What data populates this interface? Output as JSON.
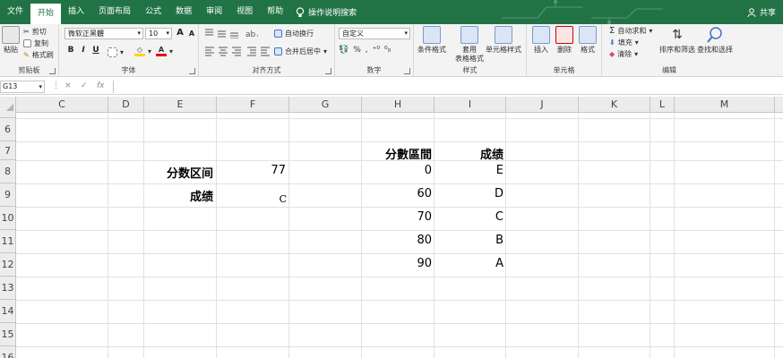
{
  "menu": {
    "tabs": [
      "文件",
      "开始",
      "插入",
      "页面布局",
      "公式",
      "数据",
      "审阅",
      "视图",
      "帮助"
    ],
    "active": "开始",
    "tell_me": "操作说明搜索",
    "share": "共享"
  },
  "ribbon": {
    "clipboard": {
      "paste": "粘贴",
      "cut": "剪切",
      "copy": "复制",
      "format_painter": "格式刷",
      "label": "剪贴板"
    },
    "font": {
      "name": "微软正黑體",
      "size": "10",
      "grow": "A",
      "shrink": "A",
      "bold": "B",
      "italic": "I",
      "underline": "U",
      "label": "字体"
    },
    "alignment": {
      "wrap": "自动换行",
      "merge": "合并后居中",
      "label": "对齐方式"
    },
    "number": {
      "format": "自定义",
      "label": "数字"
    },
    "styles": {
      "conditional": "条件格式",
      "table_line1": "套用",
      "table_line2": "表格格式",
      "cell_styles": "单元格样式",
      "label": "样式"
    },
    "cells": {
      "insert": "插入",
      "delete": "删除",
      "format": "格式",
      "label": "单元格"
    },
    "editing": {
      "autosum": "自动求和",
      "fill": "填充",
      "clear": "清除",
      "sort": "排序和筛选",
      "find": "查找和选择",
      "label": "编辑"
    }
  },
  "formula_bar": {
    "name_box": "G13",
    "cancel": "×",
    "enter": "✓",
    "fx": "fx",
    "value": ""
  },
  "columns": [
    "C",
    "D",
    "E",
    "F",
    "G",
    "H",
    "I",
    "J",
    "K",
    "L",
    "M"
  ],
  "rows": [
    "",
    "6",
    "7",
    "8",
    "9",
    "10",
    "11",
    "12",
    "13",
    "14",
    "15",
    "16"
  ],
  "cells": {
    "e8": "分数区间",
    "f8": "77",
    "e9": "成绩",
    "f9": "C",
    "h7": "分數區間",
    "i7": "成绩",
    "table": [
      {
        "h": "0",
        "i": "E"
      },
      {
        "h": "60",
        "i": "D"
      },
      {
        "h": "70",
        "i": "C"
      },
      {
        "h": "80",
        "i": "B"
      },
      {
        "h": "90",
        "i": "A"
      }
    ]
  },
  "colors": {
    "accent": "#217346"
  }
}
